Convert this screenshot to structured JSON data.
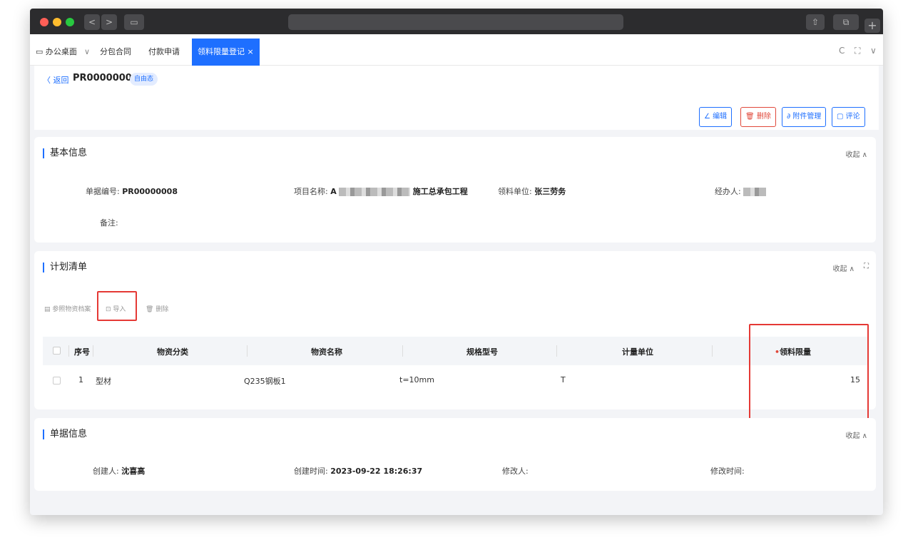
{
  "browser": {
    "nav_back": "<",
    "nav_forward": ">",
    "sidebar_toggle": "▭",
    "new_tab": "+"
  },
  "tabs": {
    "home": "办公桌面",
    "home_dropdown": "∨",
    "tab1": "分包合同",
    "tab2": "付款申请",
    "tab3": "领料限量登记",
    "tab3_close": "×",
    "refresh": "C",
    "fullscreen": "⛶",
    "more": "∨"
  },
  "header": {
    "back_label": "〈 返回",
    "doc_no": "PR00000008",
    "status": "自由态",
    "actions": {
      "edit": "编辑",
      "delete": "删除",
      "attachments": "附件管理",
      "comment": "评论"
    }
  },
  "basic_info": {
    "title": "基本信息",
    "collapse": "收起 ∧",
    "doc_no_label": "单据编号:",
    "doc_no_value": "PR00000008",
    "project_label": "项目名称:",
    "project_prefix": "A",
    "project_suffix": "施工总承包工程",
    "unit_label": "领料单位:",
    "unit_value": "张三劳务",
    "handler_label": "经办人:",
    "remark_label": "备注:"
  },
  "plan": {
    "title": "计划清单",
    "collapse": "收起 ∧",
    "fullscreen": "⛶",
    "tool_ref": "参照物资档案",
    "tool_import": "导入",
    "tool_delete": "删除",
    "columns": [
      "序号",
      "物资分类",
      "物资名称",
      "规格型号",
      "计量单位",
      "领料限量"
    ],
    "rows": [
      {
        "no": "1",
        "category": "型材",
        "name": "Q235钢板1",
        "spec": "t=10mm",
        "unit": "T",
        "limit": "15"
      }
    ]
  },
  "doc_info": {
    "title": "单据信息",
    "collapse": "收起 ∧",
    "creator_label": "创建人:",
    "creator_value": "沈喜高",
    "created_label": "创建时间:",
    "created_value": "2023-09-22 18:26:37",
    "modifier_label": "修改人:",
    "modified_label": "修改时间:"
  },
  "colors": {
    "accent": "#1e6fff",
    "danger": "#e0483a",
    "highlight_box": "#e53935"
  }
}
